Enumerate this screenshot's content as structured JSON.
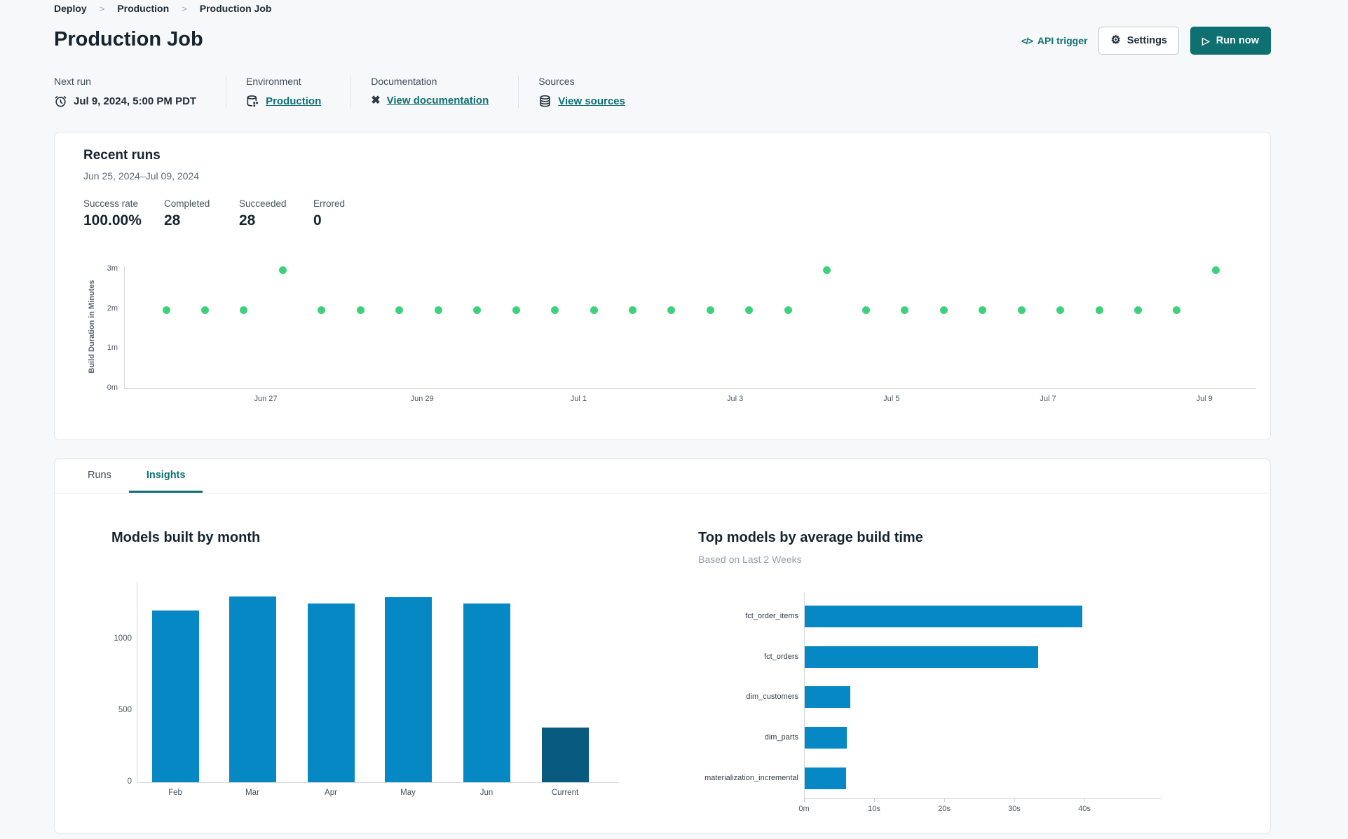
{
  "breadcrumb": {
    "items": [
      "Deploy",
      "Production",
      "Production Job"
    ]
  },
  "header": {
    "title": "Production Job",
    "api_trigger_label": "API trigger",
    "settings_label": "Settings",
    "run_now_label": "Run now"
  },
  "meta": {
    "next_run": {
      "label": "Next run",
      "value": "Jul 9, 2024, 5:00 PM PDT"
    },
    "environment": {
      "label": "Environment",
      "value": "Production"
    },
    "documentation": {
      "label": "Documentation",
      "value": "View documentation"
    },
    "sources": {
      "label": "Sources",
      "value": "View sources"
    }
  },
  "recent_runs": {
    "title": "Recent runs",
    "date_range": "Jun 25, 2024–Jul 09, 2024",
    "stats": [
      {
        "label": "Success rate",
        "value": "100.00%"
      },
      {
        "label": "Completed",
        "value": "28"
      },
      {
        "label": "Succeeded",
        "value": "28"
      },
      {
        "label": "Errored",
        "value": "0"
      }
    ]
  },
  "tabs": [
    {
      "label": "Runs",
      "active": false
    },
    {
      "label": "Insights",
      "active": true
    }
  ],
  "colors": {
    "accent_teal": "#0f7072",
    "success_green": "#3ed17c",
    "bar_blue": "#0688c4",
    "bar_dark_blue": "#095a7f"
  },
  "chart_data": [
    {
      "id": "build-duration-scatter",
      "type": "scatter",
      "ylabel": "Build Duration in Minutes",
      "yticks": [
        "0m",
        "1m",
        "2m",
        "3m"
      ],
      "ylim": [
        0,
        3.2
      ],
      "xticks": [
        "Jun 27",
        "Jun 29",
        "Jul 1",
        "Jul 3",
        "Jul 5",
        "Jul 7",
        "Jul 9"
      ],
      "points_minutes": [
        1.97,
        1.97,
        1.97,
        2.97,
        1.97,
        1.97,
        1.97,
        1.97,
        1.97,
        1.97,
        1.97,
        1.97,
        1.97,
        1.97,
        1.97,
        1.97,
        1.97,
        2.97,
        1.97,
        1.97,
        1.97,
        1.97,
        1.97,
        1.97,
        1.97,
        1.97,
        1.97,
        2.97
      ],
      "point_color": "#3ed17c",
      "grid": false,
      "legend": "none"
    },
    {
      "id": "models-built-by-month",
      "type": "bar",
      "title": "Models built by month",
      "categories": [
        "Feb",
        "Mar",
        "Apr",
        "May",
        "Jun",
        "Current"
      ],
      "values": [
        1200,
        1300,
        1250,
        1295,
        1250,
        380
      ],
      "yticks": [
        0,
        500,
        1000
      ],
      "ylim": [
        0,
        1370
      ],
      "bar_colors": [
        "#0688c4",
        "#0688c4",
        "#0688c4",
        "#0688c4",
        "#0688c4",
        "#095a7f"
      ],
      "grid": false,
      "legend": "none"
    },
    {
      "id": "top-models-by-build-time",
      "type": "hbar",
      "title": "Top models by average build time",
      "subtitle": "Based on Last 2 Weeks",
      "categories": [
        "fct_order_items",
        "fct_orders",
        "dim_customers",
        "dim_parts",
        "materialization_incremental"
      ],
      "values_seconds": [
        39.6,
        33.3,
        6.5,
        6.0,
        5.9
      ],
      "xticks": [
        "0m",
        "10s",
        "20s",
        "30s",
        "40s"
      ],
      "xlim_seconds": [
        0,
        45
      ],
      "bar_color": "#0688c4",
      "grid": false,
      "legend": "none"
    }
  ]
}
